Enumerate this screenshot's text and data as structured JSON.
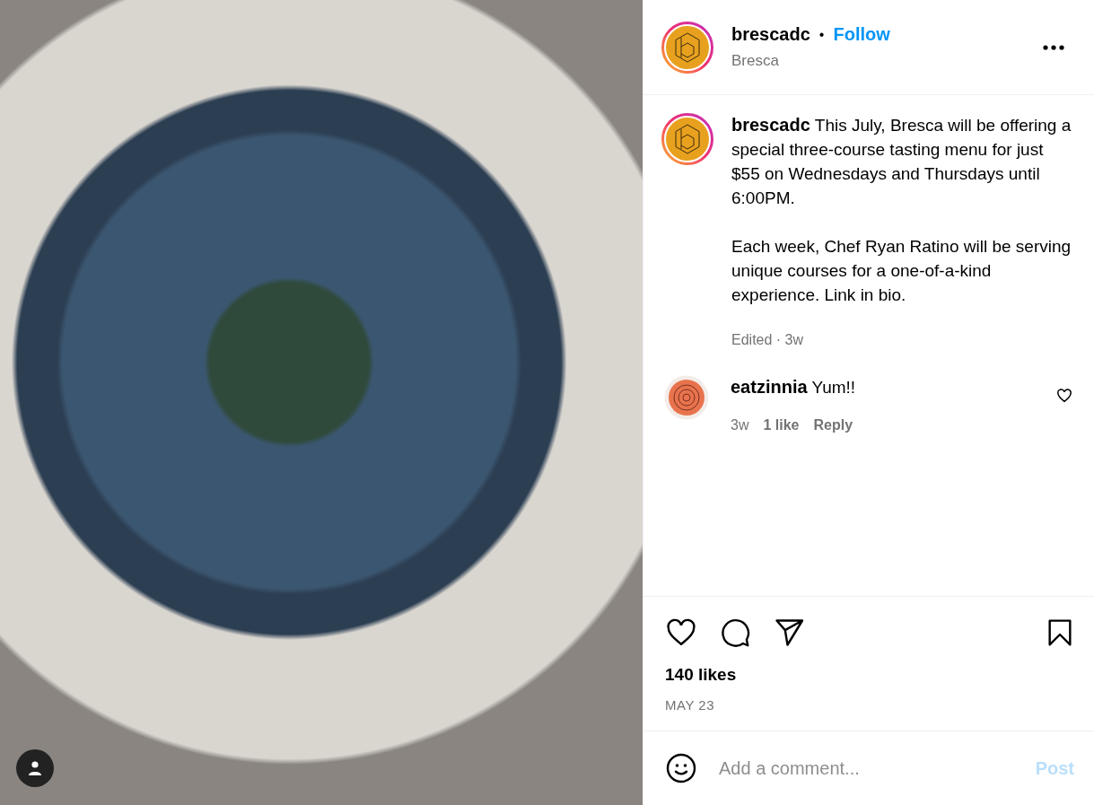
{
  "header": {
    "username": "brescadc",
    "separator": "•",
    "follow": "Follow",
    "location": "Bresca"
  },
  "caption": {
    "username": "brescadc",
    "paragraphs": [
      "This July, Bresca will be offering a special three-course tasting menu for just $55 on Wednesdays and Thursdays until 6:00PM.",
      "Each week, Chef Ryan Ratino will be serving unique courses for a one-of-a-kind experience. Link in bio."
    ],
    "meta": "Edited · 3w"
  },
  "comments": [
    {
      "username": "eatzinnia",
      "text": "Yum!!",
      "time": "3w",
      "likes": "1 like",
      "reply": "Reply",
      "liked": false
    }
  ],
  "likes": "140 likes",
  "date": "MAY 23",
  "comment_box": {
    "placeholder": "Add a comment...",
    "post": "Post",
    "disabled": true
  }
}
